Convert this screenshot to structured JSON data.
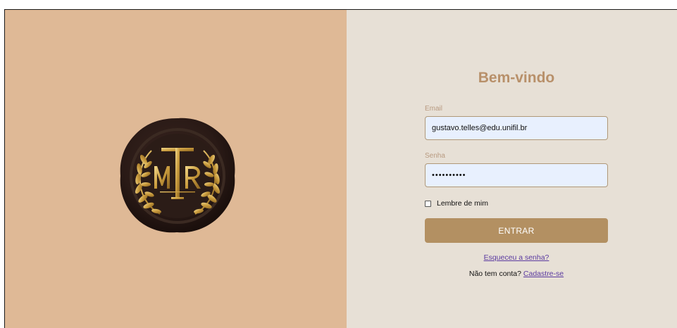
{
  "login": {
    "title": "Bem-vindo",
    "email_label": "Email",
    "email_value": "gustavo.telles@edu.unifil.br",
    "password_label": "Senha",
    "password_value": "••••••••••",
    "remember_label": "Lembre de mim",
    "remember_checked": false,
    "submit_label": "ENTRAR",
    "forgot_link": "Esqueceu a senha?",
    "signup_prompt": "Não tem conta?",
    "signup_link": "Cadastre-se"
  },
  "logo": {
    "monogram": "MTR",
    "icon": "wax-seal-laurel-logo"
  },
  "colors": {
    "left_panel_bg": "#dfb996",
    "right_panel_bg": "#e7e0d6",
    "title": "#b8906a",
    "button": "#b39062",
    "input_bg": "#e8f0fe",
    "link": "#5b3aa0"
  }
}
